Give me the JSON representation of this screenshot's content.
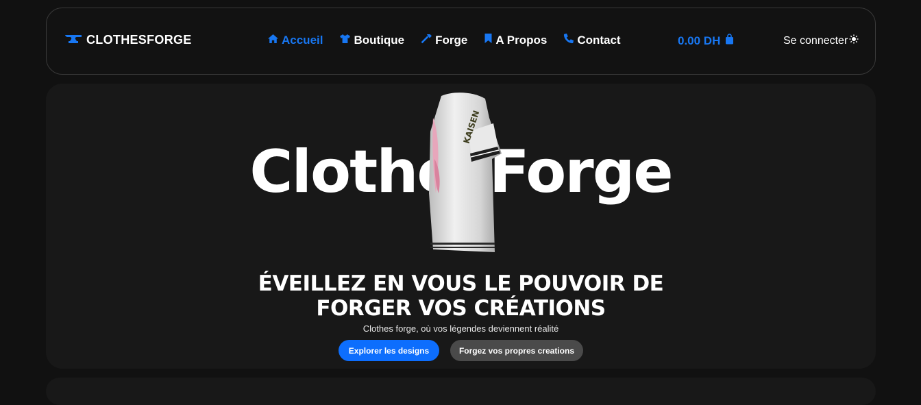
{
  "navbar": {
    "brand": "CLOTHESFORGE",
    "brand_icon": "anvil-icon",
    "links": [
      {
        "label": "Accueil",
        "icon": "home-icon",
        "active": true
      },
      {
        "label": "Boutique",
        "icon": "tshirt-icon",
        "active": false
      },
      {
        "label": "Forge",
        "icon": "hammer-icon",
        "active": false
      },
      {
        "label": "A Propos",
        "icon": "bookmark-icon",
        "active": false
      },
      {
        "label": "Contact",
        "icon": "phone-icon",
        "active": false
      }
    ],
    "cart_total": "0.00 DH",
    "cart_icon": "shopping-bag-icon",
    "login_label": "Se connecter",
    "login_icon": "sun-icon"
  },
  "hero": {
    "brand_text": "ClothesForge",
    "headline_line1": "ÉVEILLEZ EN VOUS LE POUVOIR DE",
    "headline_line2": "FORGER VOS CRÉATIONS",
    "subtitle": "Clothes forge, où vos légendes deviennent réalité",
    "primary_button": "Explorer les designs",
    "secondary_button": "Forgez vos propres creations",
    "shirt_print": "KAISEN"
  },
  "colors": {
    "accent": "#1877f2",
    "button_primary": "#0d6efd",
    "button_secondary": "#4a4a4a",
    "background": "#111111",
    "card": "#181818"
  }
}
